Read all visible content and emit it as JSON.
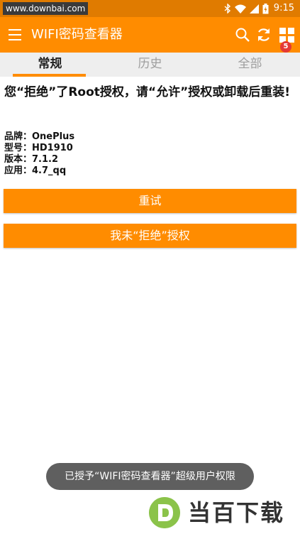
{
  "status_bar": {
    "watermark": "www.downbai.com",
    "time": "9:15"
  },
  "app_bar": {
    "title": "WIFI密码查看器",
    "badge_count": "5",
    "icons": [
      "menu-icon",
      "search-icon",
      "refresh-icon",
      "apps-icon"
    ]
  },
  "tabs": [
    {
      "label": "常规",
      "active": true
    },
    {
      "label": "历史",
      "active": false
    },
    {
      "label": "全部",
      "active": false
    }
  ],
  "main": {
    "headline": "您“拒绝”了Root授权，请“允许”授权或卸载后重装!",
    "info": [
      {
        "text": "品牌：OnePlus"
      },
      {
        "text": "型号：HD1910"
      },
      {
        "text": "版本：7.1.2"
      },
      {
        "text": "应用：4.7_qq"
      }
    ],
    "retry_label": "重试",
    "deny_label": "我未“拒绝”授权"
  },
  "toast": "已授予“WIFI密码查看器”超级用户权限",
  "logo_text": "当百下载",
  "colors": {
    "accent": "#ff8c00",
    "status_bar": "#e07b00",
    "badge": "#e53935",
    "toast_bg": "#5f5f5f"
  }
}
